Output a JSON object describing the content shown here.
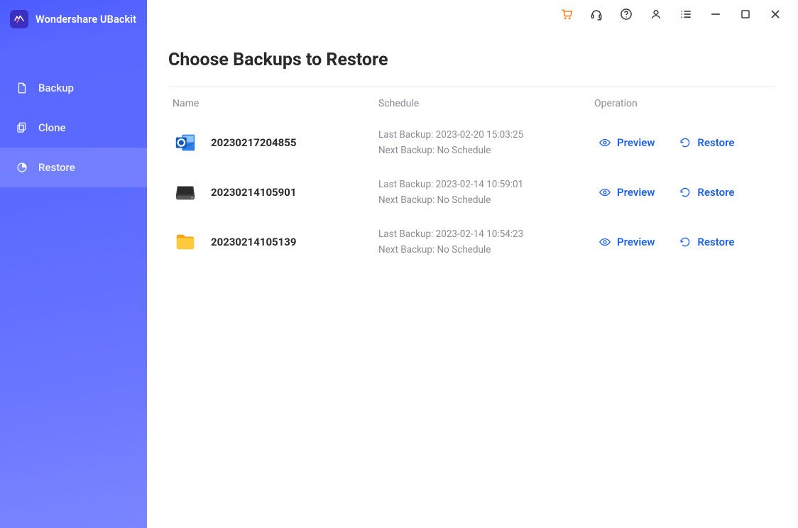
{
  "app": {
    "title": "Wondershare UBackit"
  },
  "sidebar": {
    "items": [
      {
        "label": "Backup",
        "icon": "file-icon",
        "active": false
      },
      {
        "label": "Clone",
        "icon": "copy-icon",
        "active": false
      },
      {
        "label": "Restore",
        "icon": "pie-icon",
        "active": true
      }
    ]
  },
  "page": {
    "title": "Choose Backups to Restore",
    "columns": {
      "name": "Name",
      "schedule": "Schedule",
      "operation": "Operation"
    }
  },
  "labels": {
    "preview": "Preview",
    "restore": "Restore"
  },
  "backups": [
    {
      "icon": "outlook-icon",
      "name": "20230217204855",
      "last": "Last Backup: 2023-02-20 15:03:25",
      "next": "Next Backup: No Schedule"
    },
    {
      "icon": "disk-icon",
      "name": "20230214105901",
      "last": "Last Backup: 2023-02-14 10:59:01",
      "next": "Next Backup: No Schedule"
    },
    {
      "icon": "folder-icon",
      "name": "20230214105139",
      "last": "Last Backup: 2023-02-14 10:54:23",
      "next": "Next Backup: No Schedule"
    }
  ],
  "colors": {
    "accent": "#1f63e6",
    "sidebar_top": "#4c5cfc",
    "sidebar_bottom": "#7a86ff",
    "cart": "#ff7a1a"
  }
}
